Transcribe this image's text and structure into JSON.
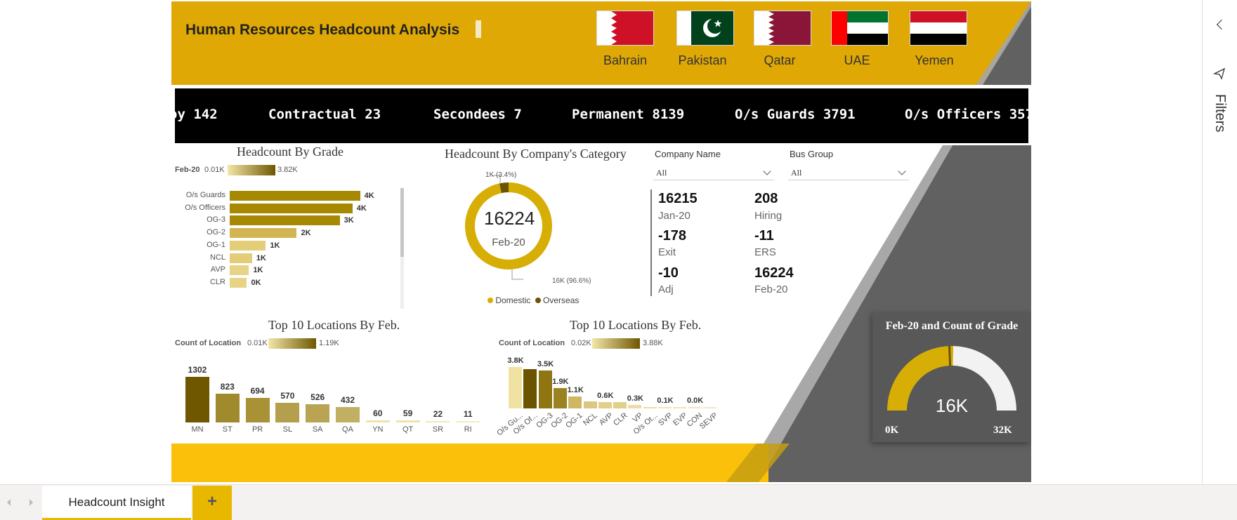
{
  "header": {
    "title": "Human Resources Headcount Analysis"
  },
  "countries": [
    {
      "name": "Bahrain",
      "icon": "bahrain-flag-icon"
    },
    {
      "name": "Pakistan",
      "icon": "pakistan-flag-icon"
    },
    {
      "name": "Qatar",
      "icon": "qatar-flag-icon"
    },
    {
      "name": "UAE",
      "icon": "uae-flag-icon"
    },
    {
      "name": "Yemen",
      "icon": "yemen-flag-icon"
    }
  ],
  "ticker": [
    "oy 142",
    "Contractual 23",
    "Secondees 7",
    "Permanent 8139",
    "O/s Guards 3791",
    "O/s Officers 357"
  ],
  "grade_chart": {
    "title": "Headcount By Grade",
    "legend": {
      "field": "Feb-20",
      "min": "0.01K",
      "max": "3.82K"
    },
    "categories": [
      "O/s Guards",
      "O/s Officers",
      "OG-3",
      "OG-2",
      "OG-1",
      "NCL",
      "AVP",
      "CLR"
    ],
    "values": [
      3791,
      3570,
      3200,
      1950,
      1050,
      650,
      560,
      500
    ],
    "labels": [
      "4K",
      "4K",
      "3K",
      "2K",
      "1K",
      "1K",
      "1K",
      "0K"
    ],
    "colors": [
      "#a68900",
      "#a68900",
      "#a68900",
      "#d1b552",
      "#e4cd78",
      "#e4cd78",
      "#e7d386",
      "#e7d386"
    ]
  },
  "category_chart": {
    "title": "Headcount By Company's Category",
    "center_value": "16224",
    "center_label": "Feb-20",
    "slices": [
      {
        "name": "Domestic",
        "value": 96.6,
        "label": "16K (96.6%)",
        "color": "#d6ae05"
      },
      {
        "name": "Overseas",
        "value": 3.4,
        "label": "1K (3.4%)",
        "color": "#6b5400"
      }
    ]
  },
  "slicers": [
    {
      "label": "Company Name",
      "value": "All"
    },
    {
      "label": "Bus Group",
      "value": "All"
    }
  ],
  "kpis": [
    {
      "value": "16215",
      "label": "Jan-20"
    },
    {
      "value": "208",
      "label": "Hiring"
    },
    {
      "value": "-178",
      "label": "Exit"
    },
    {
      "value": "-11",
      "label": "ERS"
    },
    {
      "value": "-10",
      "label": "Adj"
    },
    {
      "value": "16224",
      "label": "Feb-20"
    }
  ],
  "location_chart": {
    "title": "Top 10 Locations By Feb.",
    "legend": {
      "field": "Count of Location",
      "min": "0.01K",
      "max": "1.19K"
    },
    "categories": [
      "MN",
      "ST",
      "PR",
      "SL",
      "SA",
      "QA",
      "YN",
      "QT",
      "SR",
      "RI"
    ],
    "values": [
      1302,
      823,
      694,
      570,
      526,
      432,
      60,
      59,
      22,
      11
    ],
    "colors": [
      "#6f5700",
      "#a08a2e",
      "#a99235",
      "#b39f4c",
      "#b8a453",
      "#c1b064",
      "#ede3b0",
      "#ede3b0",
      "#f0e7b8",
      "#f2ebc2"
    ]
  },
  "location_grade_chart": {
    "title": "Top 10 Locations By Feb.",
    "legend": {
      "field": "Count of Location",
      "min": "0.02K",
      "max": "3.88K"
    },
    "categories": [
      "O/s Gu...",
      "O/s Of...",
      "OG-3",
      "OG-2",
      "OG-1",
      "NCL",
      "AVP",
      "CLR",
      "VP",
      "O/s Ot...",
      "SVP",
      "EVP",
      "CON",
      "SEVP"
    ],
    "values": [
      3800,
      3600,
      3500,
      1900,
      1100,
      650,
      600,
      550,
      300,
      150,
      100,
      80,
      30,
      20
    ],
    "labels": [
      "3.8K",
      "",
      "3.5K",
      "1.9K",
      "1.1K",
      "",
      "0.6K",
      "",
      "0.3K",
      "",
      "0.1K",
      "",
      "0.0K",
      ""
    ],
    "colors": [
      "#f0e2a2",
      "#6b5400",
      "#8f7612",
      "#9a8220",
      "#cdb764",
      "#dcc77f",
      "#e2cf8a",
      "#e2cf8a",
      "#ecdca8",
      "#ecdca8",
      "#f0e4b8",
      "#f0e4b8",
      "#f2e8c0",
      "#f2e8c0"
    ]
  },
  "gauge": {
    "title": "Feb-20 and Count of Grade",
    "value": 16224,
    "max": 32000,
    "value_label": "16K",
    "min_label": "0K",
    "max_label": "32K"
  },
  "tabs": {
    "active": "Headcount Insight",
    "add": "+"
  },
  "pane": {
    "filters_label": "Filters"
  }
}
